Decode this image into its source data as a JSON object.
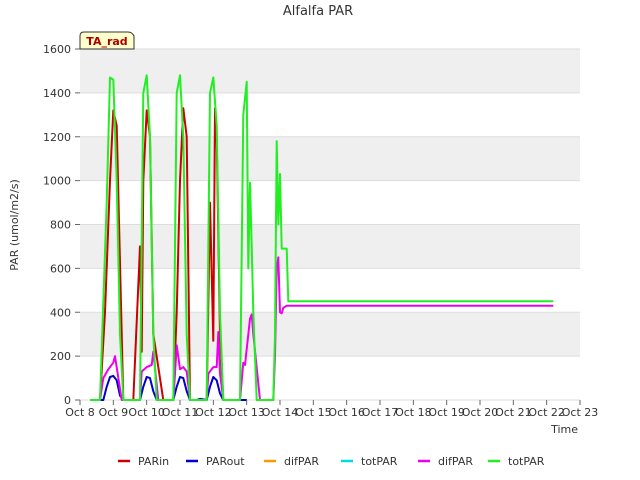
{
  "chart_data": {
    "type": "line",
    "title": "Alfalfa PAR",
    "xlabel": "Time",
    "ylabel": "PAR (umol/m2/s)",
    "badge": "TA_rad",
    "x_ticks": [
      "Oct 8",
      "Oct 9",
      "Oct 10",
      "Oct 11",
      "Oct 12",
      "Oct 13",
      "Oct 14",
      "Oct 15",
      "Oct 16",
      "Oct 17",
      "Oct 18",
      "Oct 19",
      "Oct 20",
      "Oct 21",
      "Oct 22",
      "Oct 23"
    ],
    "xlim": [
      0,
      15
    ],
    "ylim": [
      0,
      1600
    ],
    "y_ticks": [
      0,
      200,
      400,
      600,
      800,
      1000,
      1200,
      1400,
      1600
    ],
    "grid": true,
    "legend_position": "bottom",
    "series": [
      {
        "name": "PARin",
        "color": "#cc0000",
        "x": [
          0.3,
          0.6,
          0.75,
          0.9,
          1.0,
          1.1,
          1.3,
          1.6,
          1.8,
          1.85,
          1.9,
          2.0,
          2.1,
          2.2,
          2.5,
          2.8,
          2.9,
          3.0,
          3.1,
          3.2,
          3.3,
          3.5,
          3.8,
          3.9,
          4.0,
          4.05,
          4.1,
          4.2,
          4.3,
          5.0
        ],
        "y": [
          0,
          0,
          400,
          1000,
          1320,
          1250,
          0,
          0,
          700,
          220,
          1000,
          1320,
          1200,
          300,
          0,
          0,
          400,
          1000,
          1330,
          1200,
          0,
          0,
          0,
          900,
          270,
          1330,
          1200,
          300,
          0,
          0
        ]
      },
      {
        "name": "PARout",
        "color": "#0000cc",
        "x": [
          0.3,
          0.7,
          0.8,
          0.9,
          1.0,
          1.1,
          1.2,
          1.3,
          1.8,
          1.9,
          2.0,
          2.1,
          2.2,
          2.3,
          2.8,
          2.9,
          3.0,
          3.1,
          3.2,
          3.3,
          3.5,
          3.6,
          3.8,
          3.9,
          4.0,
          4.1,
          4.2,
          4.3,
          5.0
        ],
        "y": [
          0,
          0,
          60,
          105,
          110,
          90,
          20,
          0,
          0,
          60,
          105,
          100,
          40,
          0,
          0,
          60,
          105,
          100,
          40,
          0,
          0,
          5,
          0,
          60,
          105,
          90,
          30,
          0,
          0
        ]
      },
      {
        "name": "difPAR",
        "color": "#ff9900",
        "x": [],
        "y": []
      },
      {
        "name": "totPAR",
        "color": "#00dddd",
        "x": [],
        "y": []
      },
      {
        "name": "difPAR",
        "color": "#ee00ee",
        "x": [
          0.3,
          0.6,
          0.7,
          0.85,
          1.0,
          1.05,
          1.1,
          1.25,
          1.8,
          1.85,
          2.0,
          2.15,
          2.2,
          2.35,
          2.8,
          2.85,
          2.9,
          3.0,
          3.1,
          3.2,
          3.3,
          3.8,
          3.85,
          4.0,
          4.1,
          4.15,
          4.2,
          4.3,
          4.8,
          4.9,
          4.95,
          5.1,
          5.15,
          5.2,
          5.4,
          5.8,
          5.85,
          5.9,
          5.95,
          6.0,
          6.05,
          6.1,
          6.2,
          7.0,
          8.0,
          10.0,
          12.0,
          14.0,
          14.2
        ],
        "y": [
          0,
          0,
          100,
          140,
          170,
          200,
          150,
          0,
          0,
          130,
          150,
          160,
          220,
          0,
          0,
          120,
          250,
          140,
          150,
          130,
          0,
          0,
          120,
          150,
          150,
          310,
          120,
          0,
          0,
          170,
          160,
          370,
          390,
          300,
          0,
          0,
          200,
          600,
          650,
          400,
          395,
          420,
          430,
          430,
          430,
          430,
          430,
          430,
          430
        ]
      },
      {
        "name": "totPAR",
        "color": "#22ee22",
        "x": [
          0.3,
          0.6,
          0.8,
          0.9,
          1.0,
          1.1,
          1.2,
          1.3,
          1.8,
          1.9,
          2.0,
          2.1,
          2.2,
          2.3,
          2.8,
          2.9,
          3.0,
          3.1,
          3.2,
          3.3,
          3.8,
          3.9,
          4.0,
          4.1,
          4.2,
          4.3,
          4.8,
          4.9,
          5.0,
          5.05,
          5.1,
          5.15,
          5.2,
          5.3,
          5.4,
          5.8,
          5.85,
          5.9,
          5.95,
          6.0,
          6.05,
          6.1,
          6.2,
          6.25,
          7.0,
          8.0,
          10.0,
          12.0,
          14.0,
          14.2
        ],
        "y": [
          0,
          0,
          900,
          1470,
          1460,
          1000,
          300,
          0,
          0,
          1400,
          1480,
          1200,
          300,
          0,
          0,
          1400,
          1480,
          1200,
          300,
          0,
          0,
          1400,
          1470,
          1250,
          400,
          0,
          0,
          1300,
          1450,
          600,
          990,
          700,
          400,
          0,
          0,
          0,
          300,
          1180,
          800,
          1030,
          690,
          690,
          690,
          450,
          450,
          450,
          450,
          450,
          450,
          450
        ]
      }
    ]
  }
}
